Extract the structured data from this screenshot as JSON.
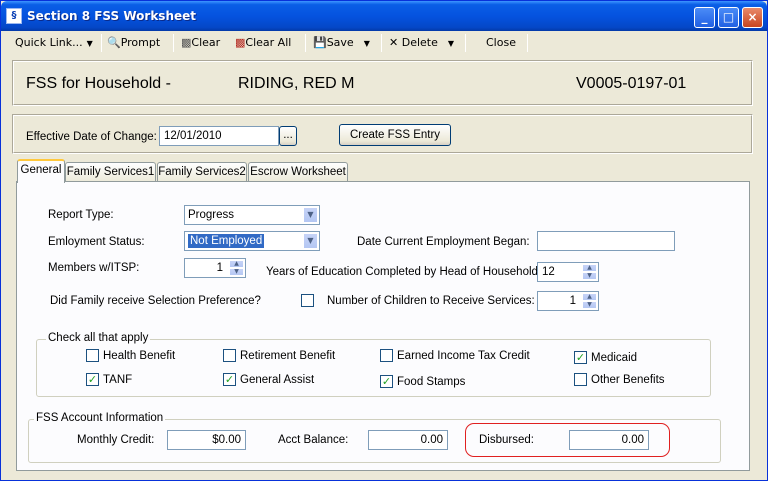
{
  "window": {
    "title": "Section 8 FSS Worksheet",
    "minimize": "_",
    "maximize": "□",
    "close": "×"
  },
  "toolbar": {
    "quick_link": "Quick Link...",
    "prompt": "Prompt",
    "clear": "Clear",
    "clear_all": "Clear All",
    "save": "Save",
    "delete": "Delete",
    "close": "Close"
  },
  "header": {
    "label": "FSS for Household -",
    "name": "RIDING, RED M",
    "id": "V0005-0197-01"
  },
  "effective": {
    "label": "Effective Date of Change:",
    "value": "12/01/2010",
    "browse": "...",
    "create_button": "Create FSS Entry"
  },
  "tabs": [
    {
      "label": "General"
    },
    {
      "label": "Family Services1"
    },
    {
      "label": "Family Services2"
    },
    {
      "label": "Escrow Worksheet"
    }
  ],
  "general": {
    "report_type_label": "Report Type:",
    "report_type_value": "Progress",
    "employment_label": "Emloyment Status:",
    "employment_value": "Not Employed",
    "date_employment_label": "Date Current Employment Began:",
    "date_employment_value": "",
    "members_label": "Members w/ITSP:",
    "members_value": "1",
    "education_label": "Years of Education Completed by Head of Household:",
    "education_value": "12",
    "selection_pref_label": "Did Family receive Selection Preference?",
    "selection_pref_checked": false,
    "children_label": "Number of Children to Receive Services:",
    "children_value": "1"
  },
  "check_all": {
    "title": "Check all that apply",
    "items": [
      {
        "label": "Health Benefit",
        "checked": false
      },
      {
        "label": "Retirement Benefit",
        "checked": false
      },
      {
        "label": "Earned Income Tax Credit",
        "checked": false
      },
      {
        "label": "Medicaid",
        "checked": true
      },
      {
        "label": "TANF",
        "checked": true
      },
      {
        "label": "General Assist",
        "checked": true
      },
      {
        "label": "Food Stamps",
        "checked": true
      },
      {
        "label": "Other Benefits",
        "checked": false
      }
    ]
  },
  "fss_account": {
    "title": "FSS Account Information",
    "monthly_credit_label": "Monthly Credit:",
    "monthly_credit_value": "$0.00",
    "acct_balance_label": "Acct Balance:",
    "acct_balance_value": "0.00",
    "disbursed_label": "Disbursed:",
    "disbursed_value": "0.00"
  },
  "colors": {
    "title_bar": "#0553df",
    "highlight": "#e02020",
    "selected": "#316ac5"
  }
}
